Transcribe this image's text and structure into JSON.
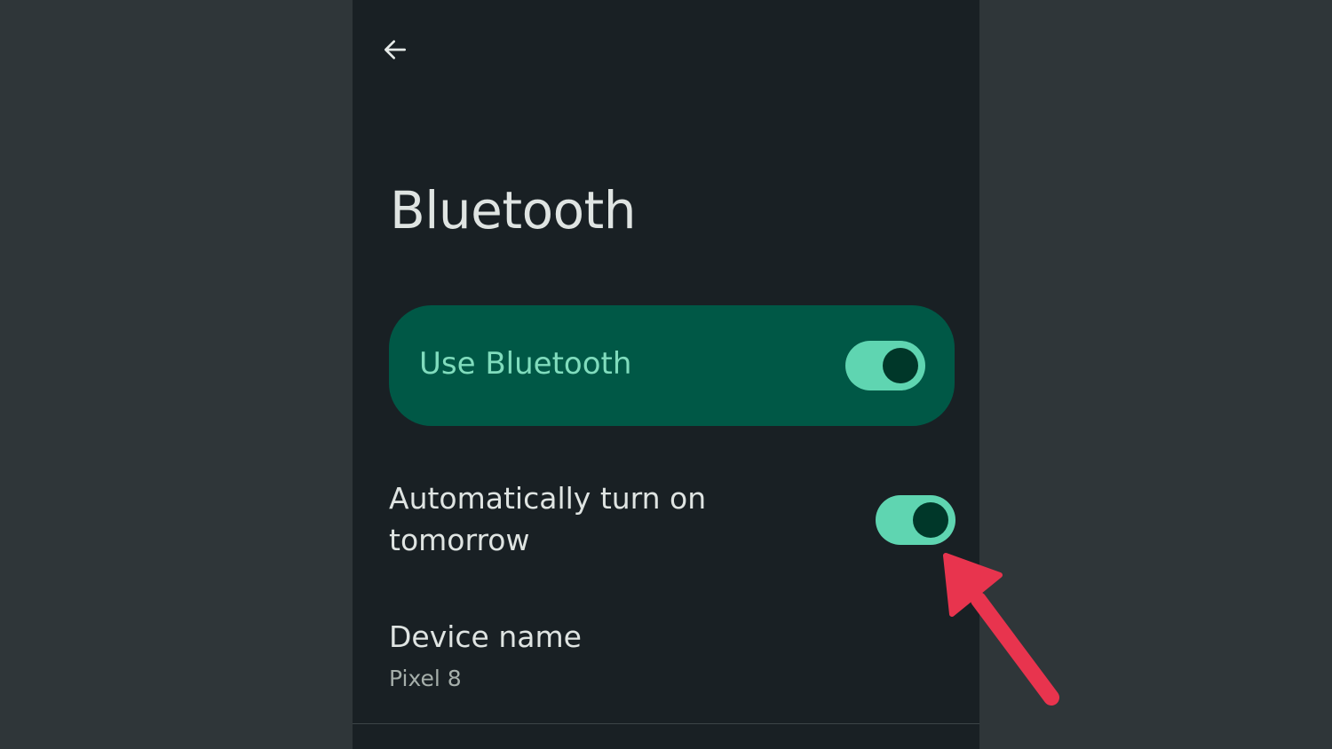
{
  "header": {
    "back_icon": "arrow-left-icon",
    "title": "Bluetooth"
  },
  "main_toggle": {
    "label": "Use Bluetooth",
    "state": "on"
  },
  "settings": {
    "auto_turn_on": {
      "label": "Automatically turn on tomorrow",
      "state": "on"
    },
    "device_name": {
      "title": "Device name",
      "value": "Pixel 8"
    }
  },
  "colors": {
    "screen_bg": "#192024",
    "outer_bg": "#2f3639",
    "card_bg": "#005846",
    "card_text": "#80dcbd",
    "switch_track": "#5fd5b1",
    "switch_thumb": "#003729",
    "annotation_arrow": "#e8344e"
  }
}
